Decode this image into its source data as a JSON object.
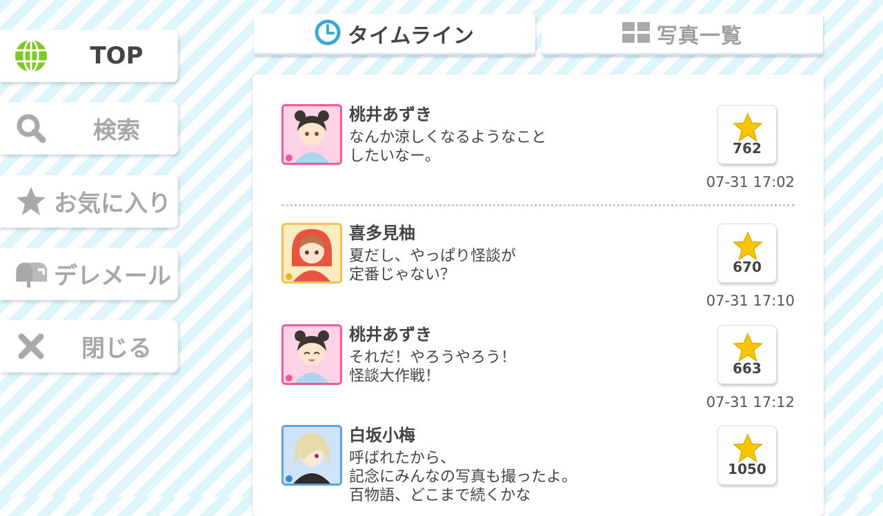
{
  "sidebar": {
    "items": [
      {
        "label": "TOP",
        "icon": "globe-icon",
        "active": true
      },
      {
        "label": "検索",
        "icon": "search-icon",
        "active": false
      },
      {
        "label": "お気に入り",
        "icon": "star-icon",
        "active": false
      },
      {
        "label": "デレメール",
        "icon": "mailbox-icon",
        "active": false
      },
      {
        "label": "閉じる",
        "icon": "close-icon",
        "active": false
      }
    ]
  },
  "tabs": [
    {
      "label": "タイムライン",
      "icon": "clock-icon",
      "active": true
    },
    {
      "label": "写真一覧",
      "icon": "grid-icon",
      "active": false
    }
  ],
  "timeline": {
    "posts": [
      {
        "name": "桃井あずき",
        "lines": [
          "なんか涼しくなるようなこと",
          "したいなー。"
        ],
        "likes": "762",
        "time": "07-31 17:02"
      },
      {
        "name": "喜多見柚",
        "lines": [
          "夏だし、やっぱり怪談が",
          "定番じゃない？"
        ],
        "likes": "670",
        "time": "07-31 17:10"
      },
      {
        "name": "桃井あずき",
        "lines": [
          "それだ！やろうやろう！",
          "怪談大作戦！"
        ],
        "likes": "663",
        "time": "07-31 17:12"
      },
      {
        "name": "白坂小梅",
        "lines": [
          "呼ばれたから、",
          "記念にみんなの写真も撮ったよ。",
          "百物語、どこまで続くかな"
        ],
        "likes": "1050",
        "time": ""
      }
    ]
  },
  "colors": {
    "stripe": "#ddf5fb",
    "globe_green": "#7dc825",
    "star_yellow": "#f7c600",
    "clock_blue": "#3aa9d6",
    "pink_frame": "#ef5a9b",
    "yellow_frame": "#f2c14a",
    "blue_frame": "#5aa0ea"
  }
}
